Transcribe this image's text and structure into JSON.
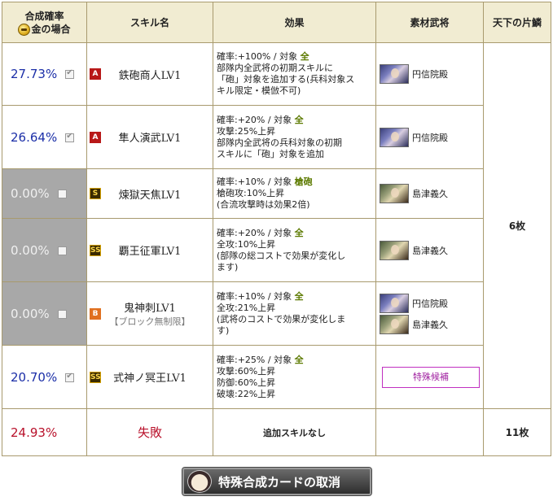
{
  "header": {
    "rate_title": "合成確率",
    "rate_sub": "金の場合",
    "skill": "スキル名",
    "effect": "効果",
    "material": "素材武将",
    "tenka": "天下の片鱗"
  },
  "rows": [
    {
      "rate": "27.73%",
      "checked": true,
      "rank": "A",
      "skill": "鉄砲商人LV1",
      "effect_lines": [
        "確率:+100% / 対象 ",
        "部隊内全武将の初期スキルに",
        "「砲」対象を追加する(兵科対象ス",
        "キル限定・模倣不可)"
      ],
      "target": "全",
      "materials": [
        {
          "name": "円信院殿",
          "portrait": "p-en"
        }
      ]
    },
    {
      "rate": "26.64%",
      "checked": true,
      "rank": "A",
      "skill": "隼人演武LV1",
      "effect_lines": [
        "確率:+20% / 対象 ",
        "攻撃:25%上昇",
        "部隊内全武将の兵科対象の初期",
        "スキルに「砲」対象を追加"
      ],
      "target": "全",
      "materials": [
        {
          "name": "円信院殿",
          "portrait": "p-en"
        }
      ]
    },
    {
      "rate": "0.00%",
      "checked": false,
      "rank": "S",
      "skill": "煉獄天焦LV1",
      "effect_lines": [
        "確率:+10% / 対象 ",
        "槍砲攻:10%上昇",
        "(合流攻撃時は効果2倍)"
      ],
      "target": "槍砲",
      "materials": [
        {
          "name": "島津義久",
          "portrait": "p-shim"
        }
      ]
    },
    {
      "rate": "0.00%",
      "checked": false,
      "rank": "SS",
      "skill": "覇王征軍LV1",
      "effect_lines": [
        "確率:+20% / 対象 ",
        "全攻:10%上昇",
        "(部隊の総コストで効果が変化し",
        "ます)"
      ],
      "target": "全",
      "materials": [
        {
          "name": "島津義久",
          "portrait": "p-shim"
        }
      ]
    },
    {
      "rate": "0.00%",
      "checked": false,
      "rank": "B",
      "skill": "鬼神刺LV1",
      "skill_sub": "【ブロック無制限】",
      "effect_lines": [
        "確率:+10% / 対象 ",
        "全攻:21%上昇",
        "(武将のコストで効果が変化しま",
        "す)"
      ],
      "target": "全",
      "materials": [
        {
          "name": "円信院殿",
          "portrait": "p-en"
        },
        {
          "name": "島津義久",
          "portrait": "p-shim"
        }
      ]
    },
    {
      "rate": "20.70%",
      "checked": true,
      "rank": "SS",
      "skill": "式神ノ冥王LV1",
      "effect_lines": [
        "確率:+25% / 対象 ",
        "攻撃:60%上昇",
        "防御:60%上昇",
        "破壊:22%上昇"
      ],
      "target": "全",
      "special_label": "特殊候補"
    }
  ],
  "tenka_value": "6枚",
  "fail": {
    "rate": "24.93%",
    "label": "失敗",
    "effect": "追加スキルなし",
    "tenka": "11枚"
  },
  "cancel_button": "特殊合成カードの取消"
}
